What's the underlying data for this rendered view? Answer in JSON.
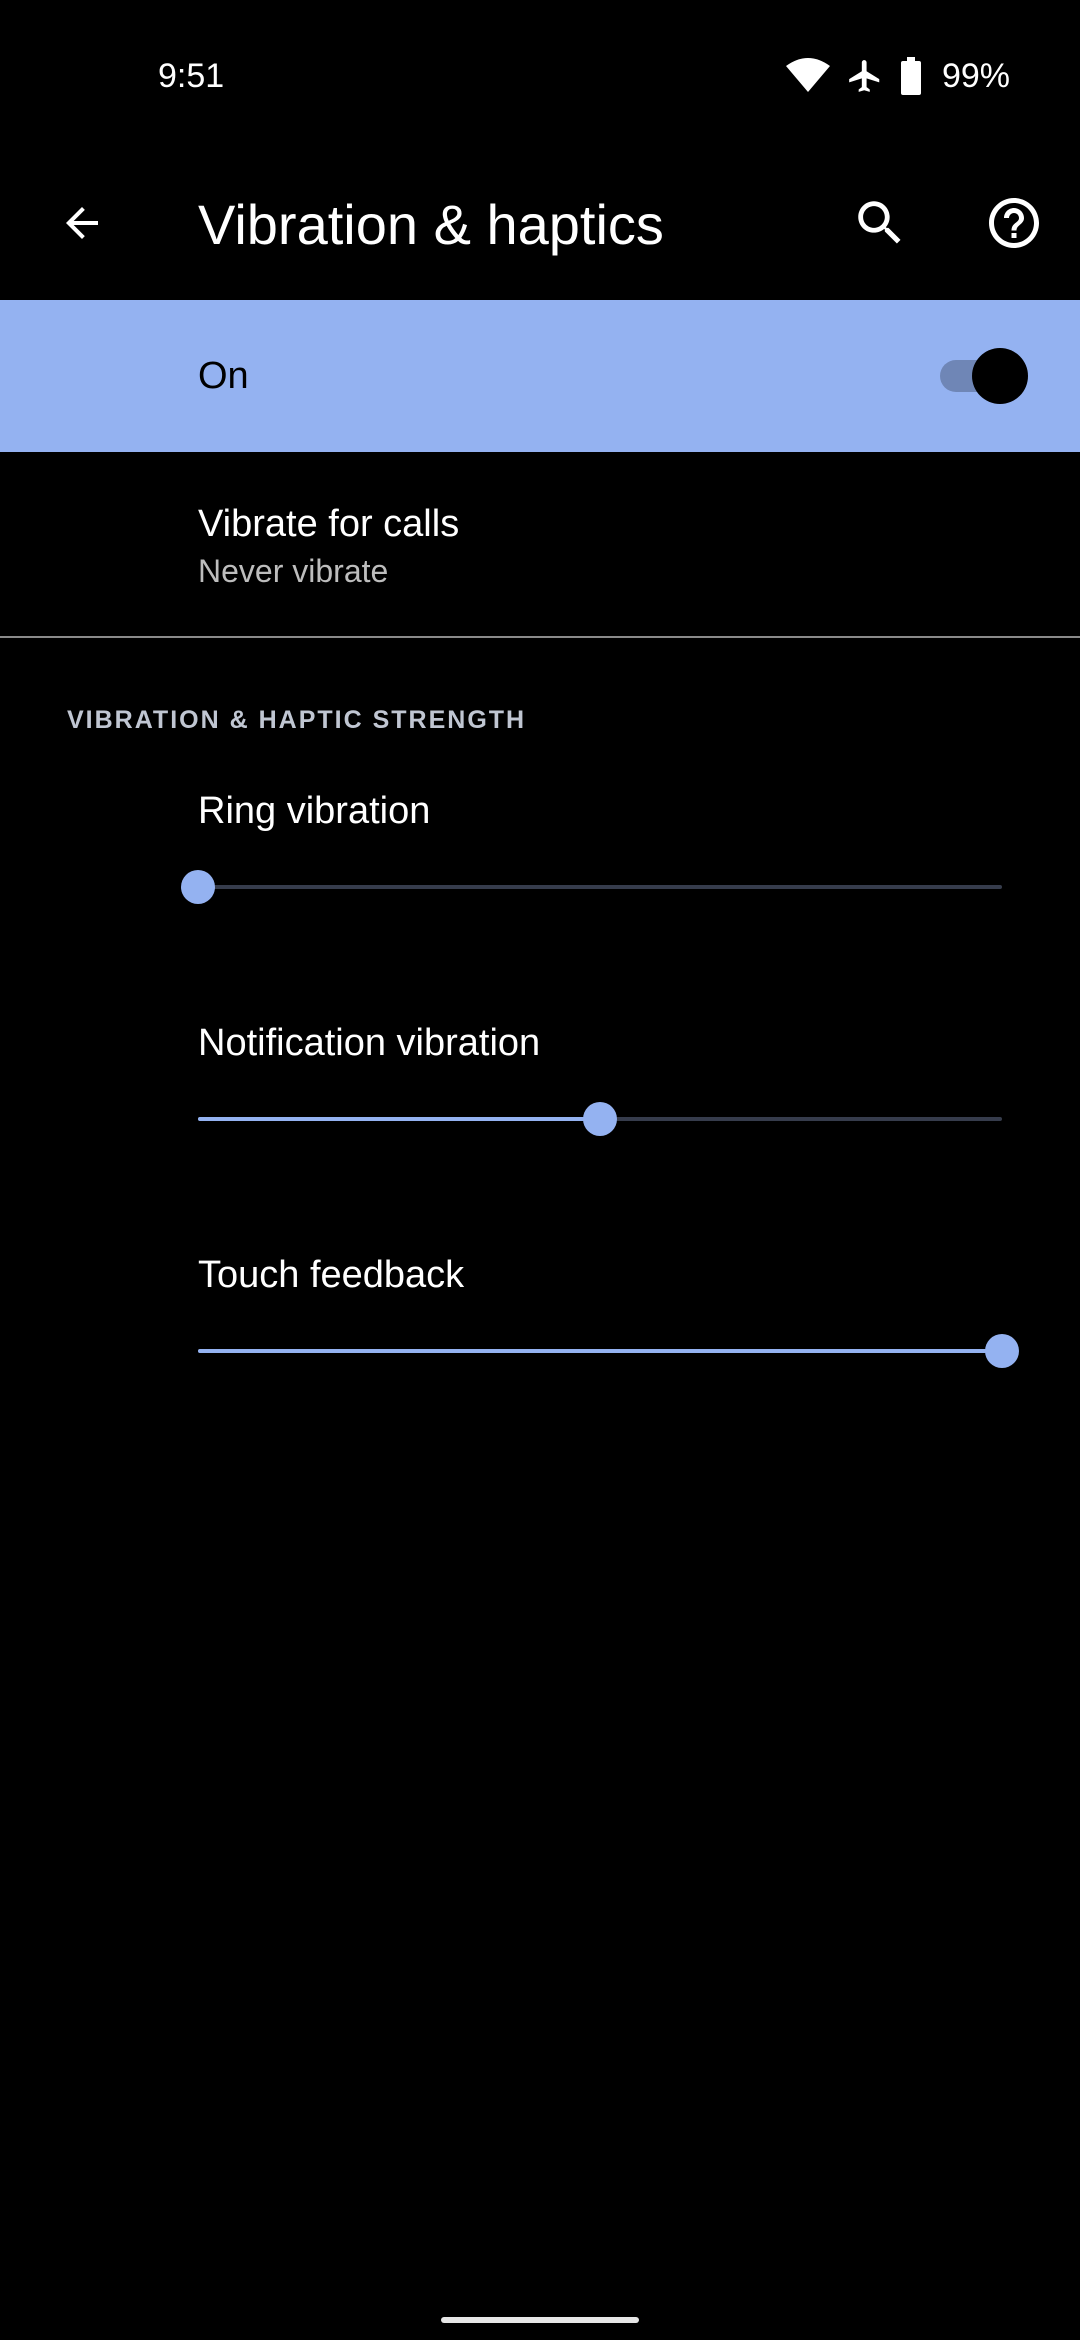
{
  "status_bar": {
    "time": "9:51",
    "battery_percent": "99%",
    "icons": [
      "wifi-icon",
      "airplane-icon",
      "battery-icon"
    ]
  },
  "app_bar": {
    "title": "Vibration & haptics",
    "back_icon": "arrow-back-icon",
    "search_icon": "search-icon",
    "help_icon": "help-icon"
  },
  "master_switch": {
    "label": "On",
    "checked": true
  },
  "vibrate_for_calls": {
    "title": "Vibrate for calls",
    "summary": "Never vibrate"
  },
  "section": {
    "header": "VIBRATION & HAPTIC STRENGTH"
  },
  "sliders": [
    {
      "label": "Ring vibration",
      "value": 0.0
    },
    {
      "label": "Notification vibration",
      "value": 0.5
    },
    {
      "label": "Touch feedback",
      "value": 1.0
    }
  ],
  "colors": {
    "accent": "#94b2f1",
    "background": "#000000",
    "track_inactive": "#363c4c",
    "summary_text": "#bdbdbd"
  }
}
